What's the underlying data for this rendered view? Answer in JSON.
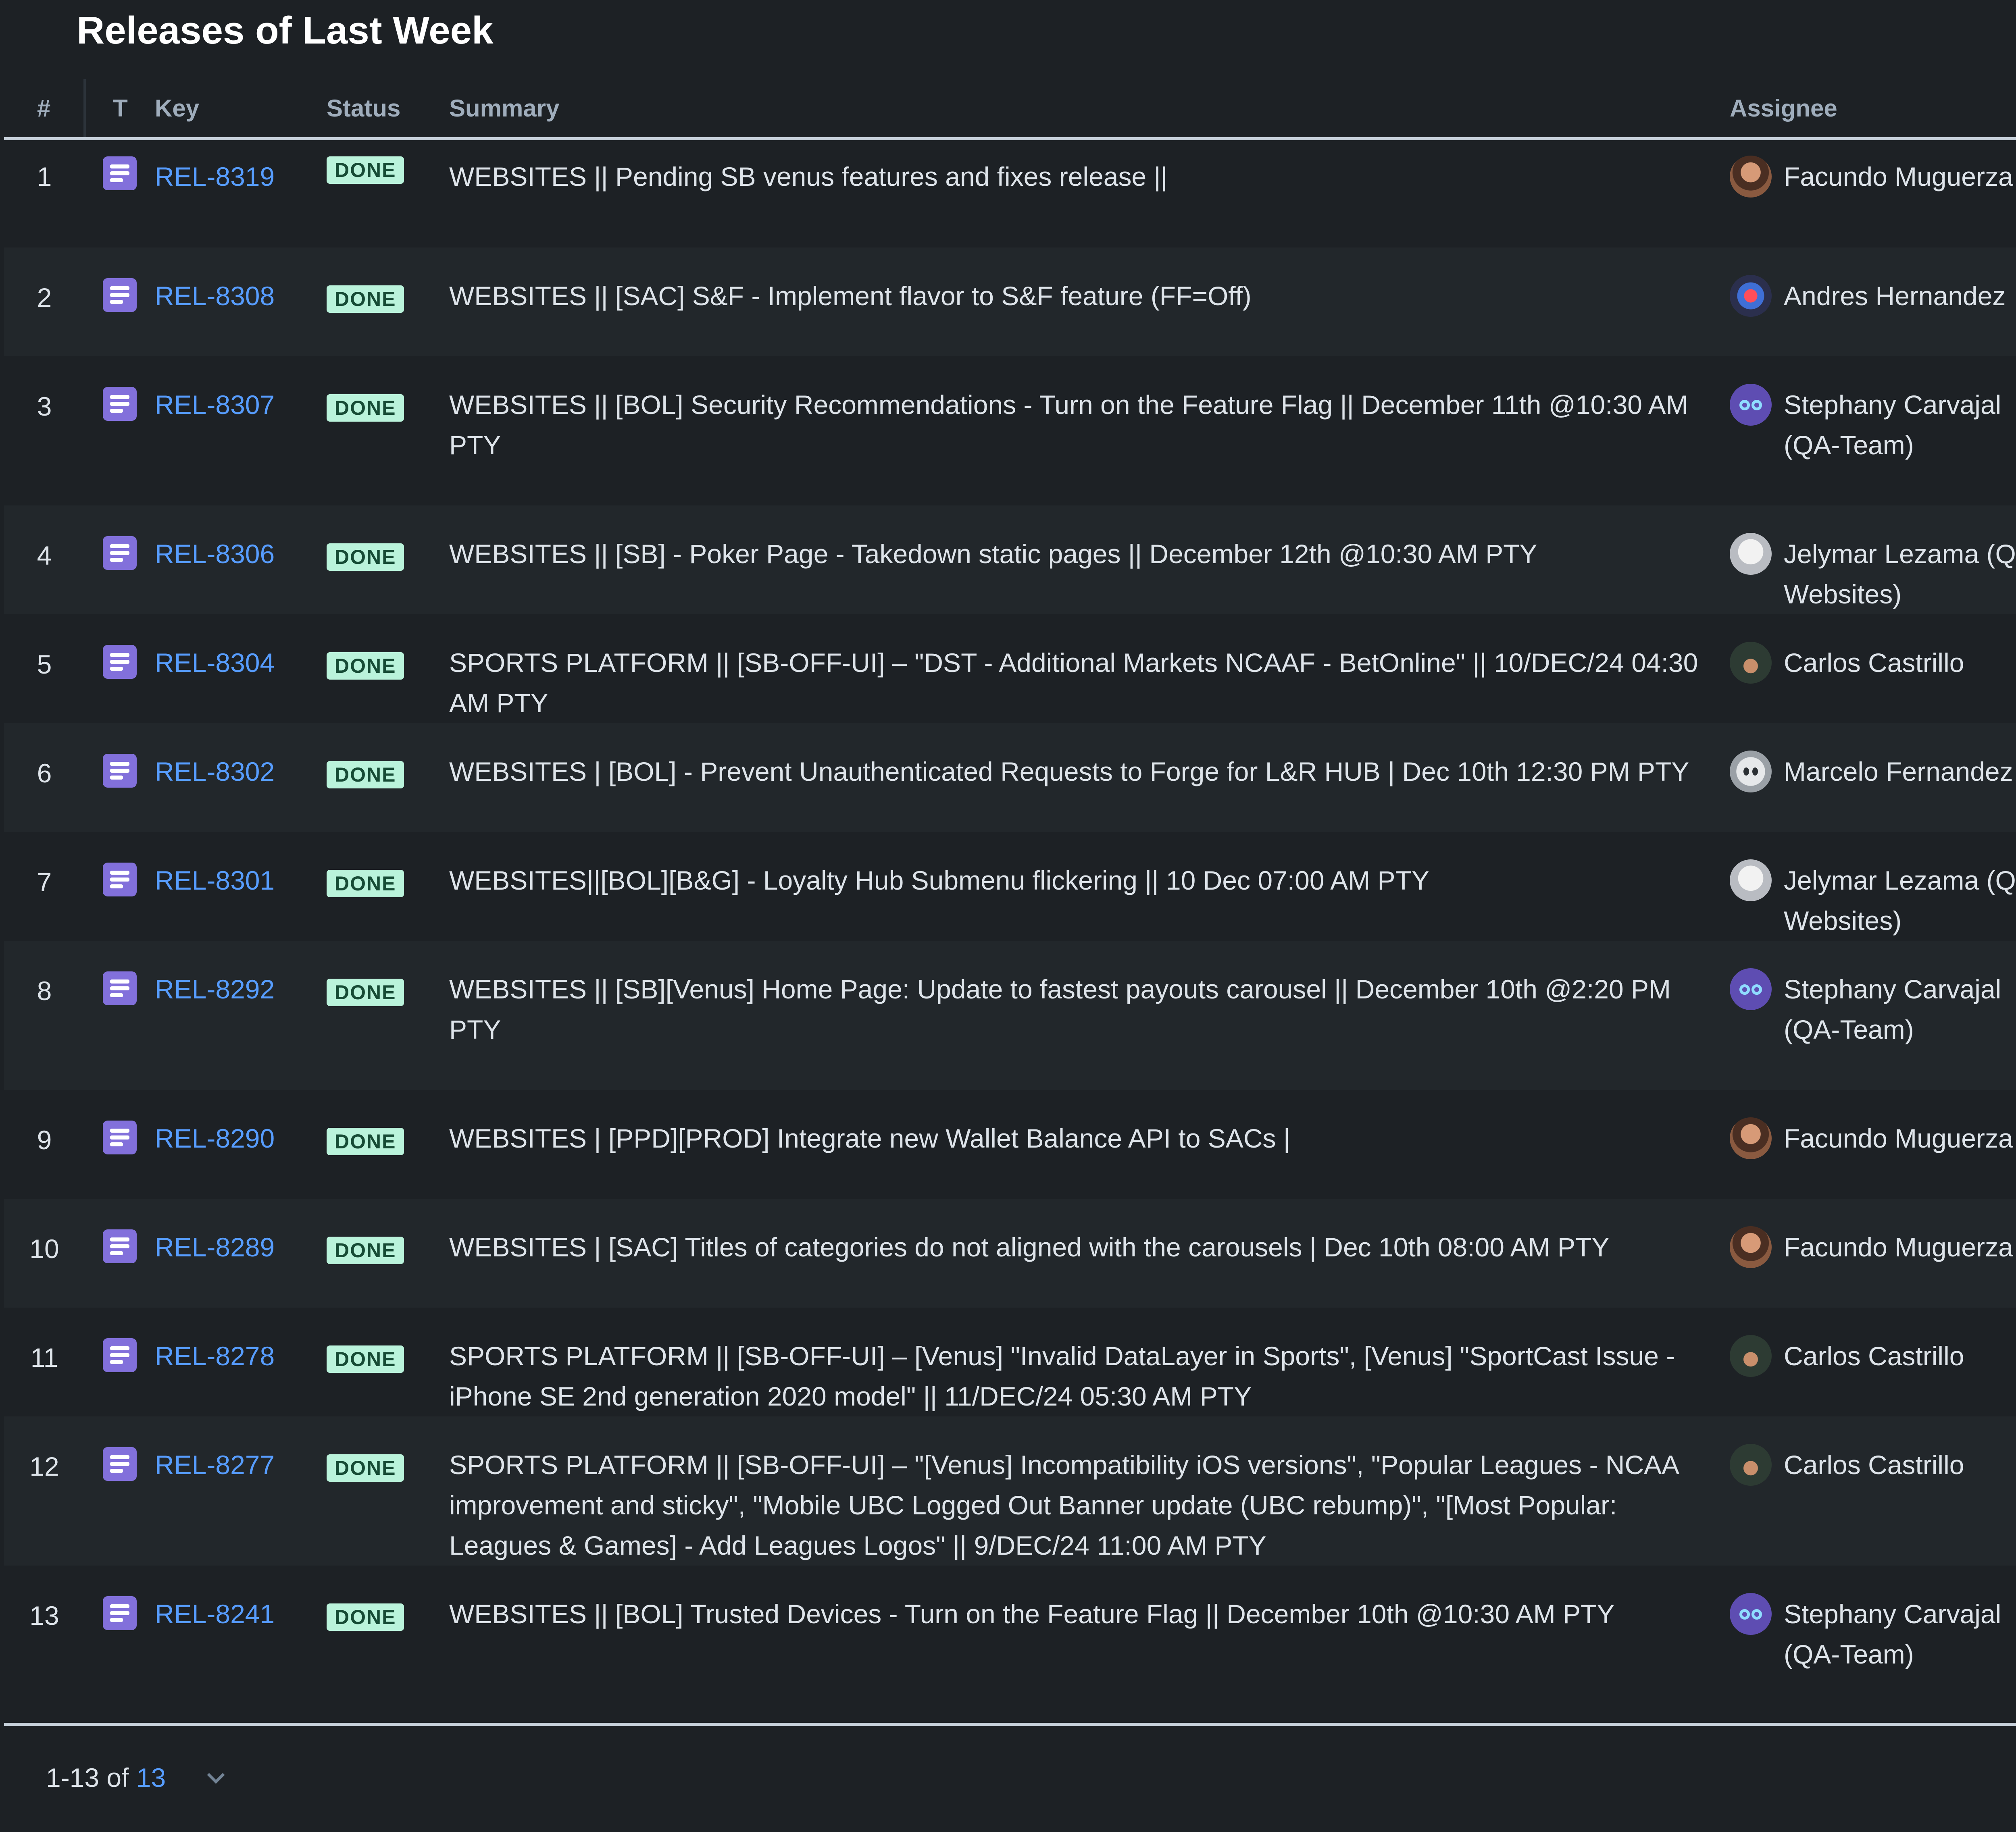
{
  "title": "Releases of Last Week",
  "columns": {
    "num": "#",
    "type": "T",
    "key": "Key",
    "status": "Status",
    "summary": "Summary",
    "assignee": "Assignee"
  },
  "rows": [
    {
      "num": "1",
      "key": "REL-8319",
      "status": "DONE",
      "summary": "WEBSITES || Pending SB venus features and fixes release ||",
      "assignee": "Facundo Muguerza",
      "avatar": "facundo"
    },
    {
      "num": "2",
      "key": "REL-8308",
      "status": "DONE",
      "summary": "WEBSITES || [SAC] S&F - Implement flavor to S&F feature (FF=Off)",
      "assignee": "Andres Hernandez",
      "avatar": "andres"
    },
    {
      "num": "3",
      "key": "REL-8307",
      "status": "DONE",
      "summary": "WEBSITES || [BOL] Security Recommendations - Turn on the Feature Flag || December 11th @10:30 AM PTY",
      "assignee": "Stephany Carvajal (QA-Team)",
      "avatar": "stephany"
    },
    {
      "num": "4",
      "key": "REL-8306",
      "status": "DONE",
      "summary": "WEBSITES || [SB] - Poker Page - Takedown static pages || December 12th @10:30 AM PTY",
      "assignee": "Jelymar Lezama (QA - Websites)",
      "avatar": "jelymar"
    },
    {
      "num": "5",
      "key": "REL-8304",
      "status": "DONE",
      "summary": "SPORTS PLATFORM || [SB-OFF-UI] – \"DST - Additional Markets NCAAF - BetOnline\" || 10/DEC/24 04:30 AM PTY",
      "assignee": "Carlos Castrillo",
      "avatar": "carlos"
    },
    {
      "num": "6",
      "key": "REL-8302",
      "status": "DONE",
      "summary": "WEBSITES | [BOL] - Prevent Unauthenticated Requests to Forge for L&R HUB | Dec 10th 12:30 PM PTY",
      "assignee": "Marcelo Fernandez",
      "avatar": "marcelo"
    },
    {
      "num": "7",
      "key": "REL-8301",
      "status": "DONE",
      "summary": "WEBSITES||[BOL][B&G] - Loyalty Hub Submenu flickering || 10 Dec 07:00 AM PTY",
      "assignee": "Jelymar Lezama (QA - Websites)",
      "avatar": "jelymar"
    },
    {
      "num": "8",
      "key": "REL-8292",
      "status": "DONE",
      "summary": "WEBSITES || [SB][Venus] Home Page: Update to fastest payouts carousel || December 10th @2:20 PM PTY",
      "assignee": "Stephany Carvajal (QA-Team)",
      "avatar": "stephany"
    },
    {
      "num": "9",
      "key": "REL-8290",
      "status": "DONE",
      "summary": "WEBSITES | [PPD][PROD] Integrate new Wallet Balance API to SACs |",
      "assignee": "Facundo Muguerza",
      "avatar": "facundo"
    },
    {
      "num": "10",
      "key": "REL-8289",
      "status": "DONE",
      "summary": "WEBSITES | [SAC] Titles of categories do not aligned with the carousels | Dec 10th 08:00 AM PTY",
      "assignee": "Facundo Muguerza",
      "avatar": "facundo"
    },
    {
      "num": "11",
      "key": "REL-8278",
      "status": "DONE",
      "summary": "SPORTS PLATFORM || [SB-OFF-UI] – [Venus] \"Invalid DataLayer in Sports\", [Venus] \"SportCast Issue - iPhone SE 2nd generation 2020 model\" || 11/DEC/24 05:30 AM PTY",
      "assignee": "Carlos Castrillo",
      "avatar": "carlos"
    },
    {
      "num": "12",
      "key": "REL-8277",
      "status": "DONE",
      "summary": "SPORTS PLATFORM || [SB-OFF-UI] – \"[Venus] Incompatibility iOS versions\", \"Popular Leagues - NCAA improvement and sticky\", \"Mobile UBC Logged Out Banner update (UBC rebump)\", \"[Most Popular: Leagues & Games] - Add Leagues Logos\" || 9/DEC/24 11:00 AM PTY",
      "assignee": "Carlos Castrillo",
      "avatar": "carlos"
    },
    {
      "num": "13",
      "key": "REL-8241",
      "status": "DONE",
      "summary": "WEBSITES || [BOL] Trusted Devices - Turn on the Feature Flag || December 10th @10:30 AM PTY",
      "assignee": "Stephany Carvajal (QA-Team)",
      "avatar": "stephany"
    }
  ],
  "footer": {
    "range": "1-13 of",
    "total": "13"
  },
  "colors": {
    "background": "#1d2125",
    "stripe": "#22272b",
    "link": "#579dff",
    "badge_bg": "#baf3db",
    "badge_text": "#164b35",
    "type_icon": "#8270db"
  },
  "icons": {
    "type": "task-icon",
    "pagination": "chevron-down-icon"
  }
}
